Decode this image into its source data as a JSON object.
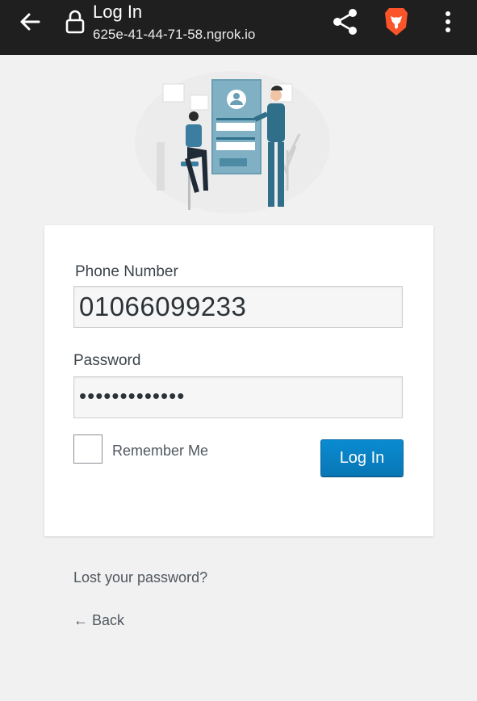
{
  "browser": {
    "title": "Log In",
    "url": "625e-41-44-71-58.ngrok.io"
  },
  "form": {
    "phone_label": "Phone Number",
    "phone_value": "01066099233",
    "password_label": "Password",
    "password_value": "•••••••••••••",
    "remember_label": "Remember Me",
    "login_button": "Log In"
  },
  "links": {
    "lost_password": "Lost your password?",
    "back": "← Back"
  }
}
